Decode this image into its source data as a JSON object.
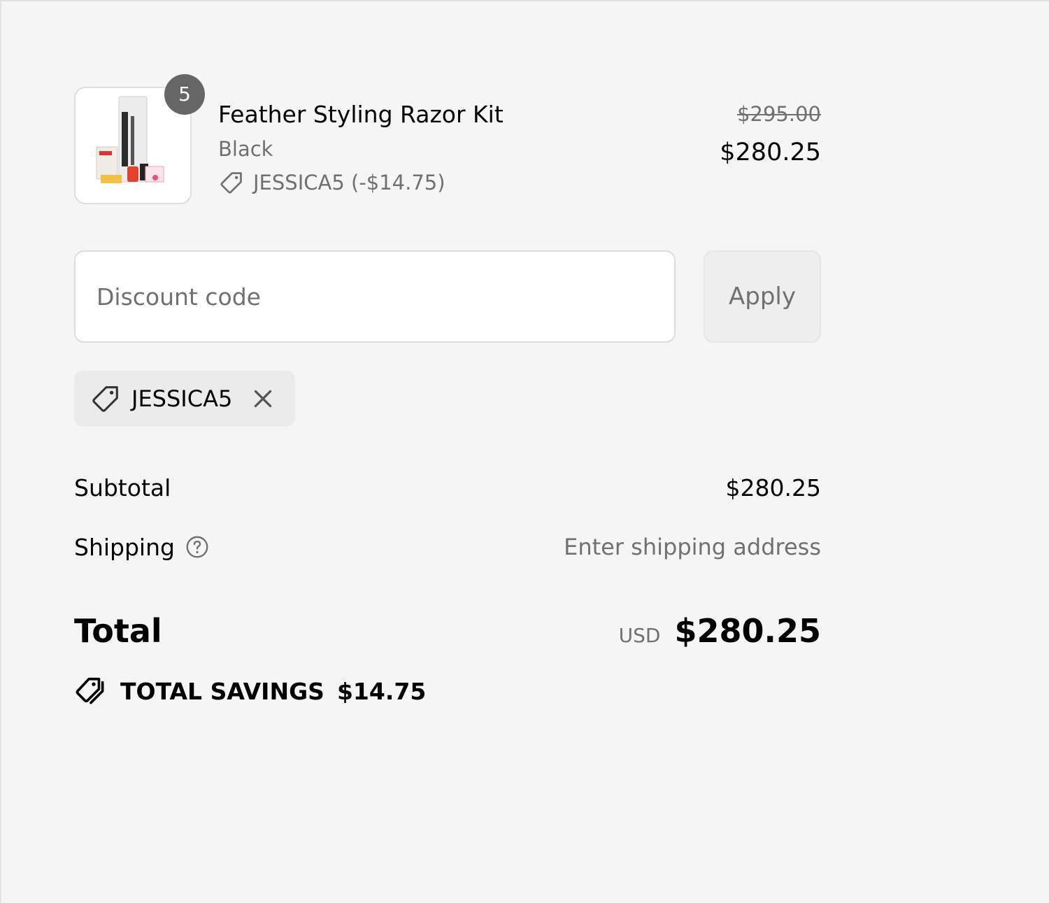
{
  "product": {
    "quantity": "5",
    "title": "Feather Styling Razor Kit",
    "variant": "Black",
    "discount_line": "JESSICA5 (-$14.75)",
    "price_original": "$295.00",
    "price_final": "$280.25",
    "thumbnail_icon": "product-image"
  },
  "discount": {
    "placeholder": "Discount code",
    "apply_label": "Apply",
    "applied_code": "JESSICA5"
  },
  "summary": {
    "subtotal_label": "Subtotal",
    "subtotal_value": "$280.25",
    "shipping_label": "Shipping",
    "shipping_value": "Enter shipping address",
    "total_label": "Total",
    "currency": "USD",
    "total_value": "$280.25",
    "savings_label": "TOTAL SAVINGS",
    "savings_value": "$14.75"
  },
  "colors": {
    "background": "#f5f5f5",
    "muted_text": "#707070",
    "badge": "#666666"
  }
}
